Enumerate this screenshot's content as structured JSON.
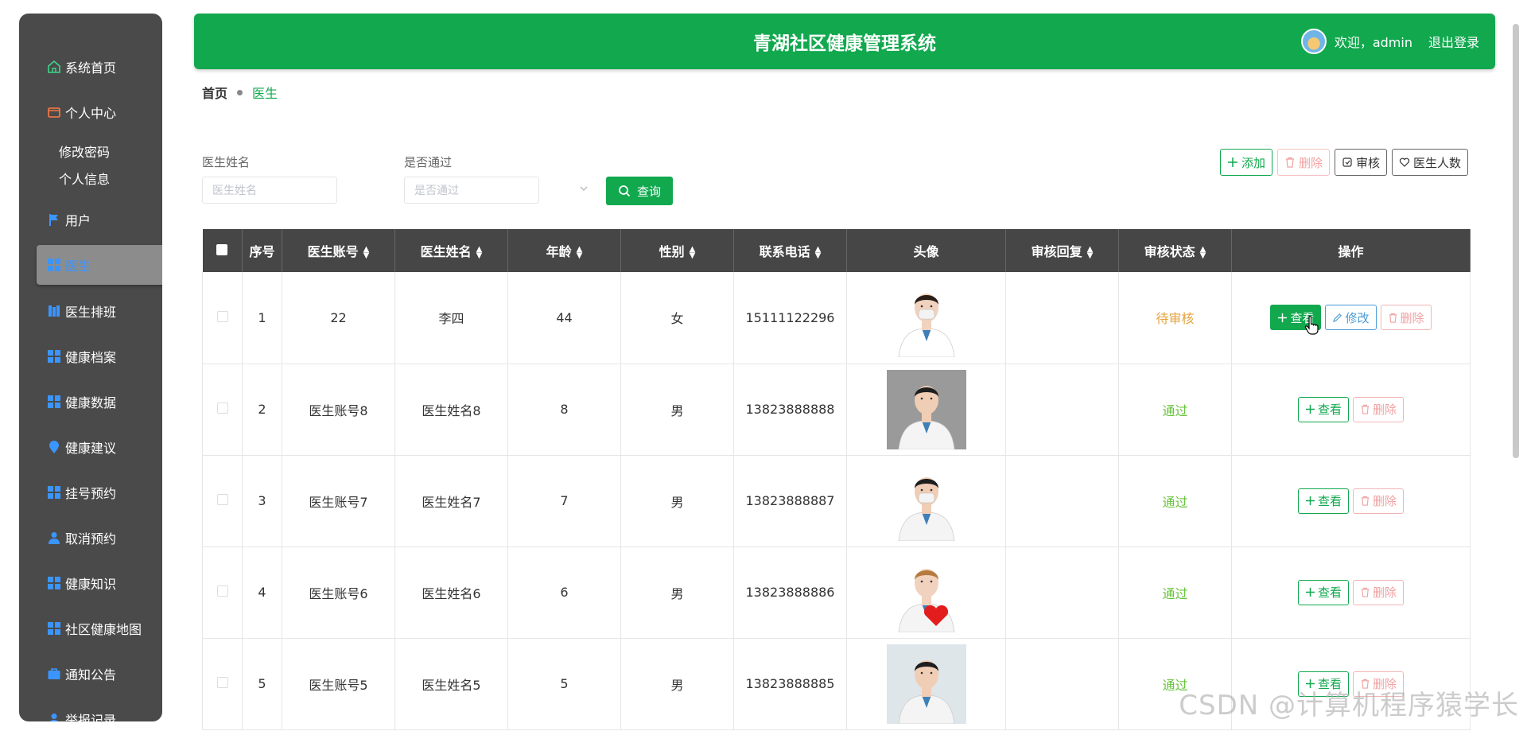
{
  "sidebar": {
    "items": [
      {
        "label": "系统首页",
        "icon": "home-icon"
      },
      {
        "label": "个人中心",
        "icon": "wallet-icon",
        "children": [
          "修改密码",
          "个人信息"
        ]
      },
      {
        "label": "用户",
        "icon": "flag-icon"
      },
      {
        "label": "医生",
        "icon": "grid-icon",
        "active": true
      },
      {
        "label": "医生排班",
        "icon": "book-icon"
      },
      {
        "label": "健康档案",
        "icon": "grid-icon"
      },
      {
        "label": "健康数据",
        "icon": "grid-icon"
      },
      {
        "label": "健康建议",
        "icon": "location-pin-icon"
      },
      {
        "label": "挂号预约",
        "icon": "grid-icon"
      },
      {
        "label": "取消预约",
        "icon": "user-icon"
      },
      {
        "label": "健康知识",
        "icon": "grid-icon"
      },
      {
        "label": "社区健康地图",
        "icon": "grid-icon"
      },
      {
        "label": "通知公告",
        "icon": "briefcase-icon"
      },
      {
        "label": "举报记录",
        "icon": "user-icon"
      }
    ]
  },
  "header": {
    "title": "青湖社区健康管理系统",
    "welcome": "欢迎，admin",
    "logout": "退出登录"
  },
  "breadcrumb": {
    "home": "首页",
    "current": "医生"
  },
  "search": {
    "name_label": "医生姓名",
    "name_placeholder": "医生姓名",
    "pass_label": "是否通过",
    "pass_placeholder": "是否通过",
    "button": "查询"
  },
  "actions": {
    "add": "添加",
    "delete": "删除",
    "review": "审核",
    "count": "医生人数"
  },
  "table": {
    "headers": [
      "序号",
      "医生账号",
      "医生姓名",
      "年龄",
      "性别",
      "联系电话",
      "头像",
      "审核回复",
      "审核状态",
      "操作"
    ],
    "rows": [
      {
        "no": "1",
        "account": "22",
        "name": "李四",
        "age": "44",
        "gender": "女",
        "phone": "15111122296",
        "reply": "",
        "status": "待审核",
        "pending": true
      },
      {
        "no": "2",
        "account": "医生账号8",
        "name": "医生姓名8",
        "age": "8",
        "gender": "男",
        "phone": "13823888888",
        "reply": "",
        "status": "通过",
        "pending": false
      },
      {
        "no": "3",
        "account": "医生账号7",
        "name": "医生姓名7",
        "age": "7",
        "gender": "男",
        "phone": "13823888887",
        "reply": "",
        "status": "通过",
        "pending": false
      },
      {
        "no": "4",
        "account": "医生账号6",
        "name": "医生姓名6",
        "age": "6",
        "gender": "男",
        "phone": "13823888886",
        "reply": "",
        "status": "通过",
        "pending": false
      },
      {
        "no": "5",
        "account": "医生账号5",
        "name": "医生姓名5",
        "age": "5",
        "gender": "男",
        "phone": "13823888885",
        "reply": "",
        "status": "通过",
        "pending": false
      }
    ],
    "op_view": "查看",
    "op_edit": "修改",
    "op_delete": "删除"
  },
  "watermark": "CSDN @计算机程序猿学长",
  "colors": {
    "primary": "#11a84e",
    "sidebar": "#4a4a4a",
    "table_header": "#464646",
    "pending": "#e6a23c",
    "pass": "#67c23a"
  }
}
